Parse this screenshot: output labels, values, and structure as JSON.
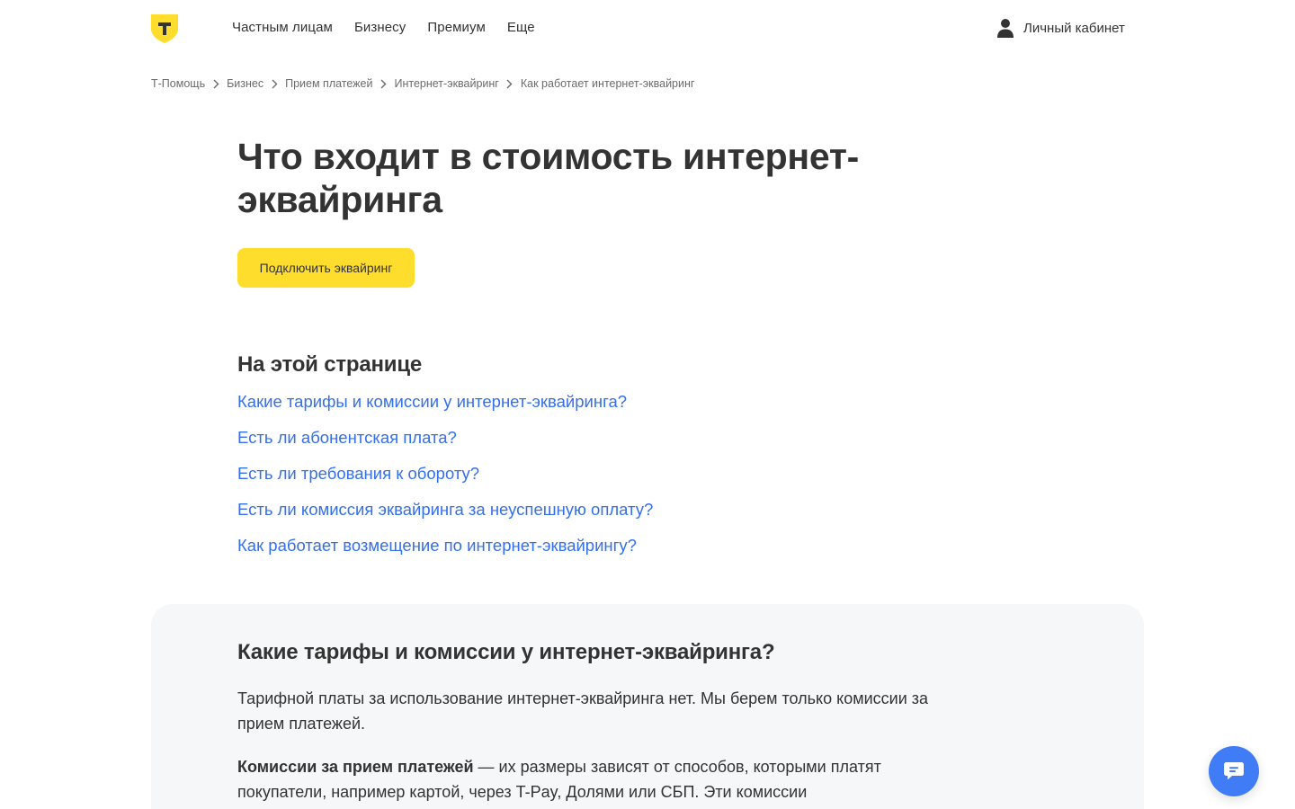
{
  "header": {
    "nav": [
      "Частным лицам",
      "Бизнесу",
      "Премиум",
      "Еще"
    ],
    "account_label": "Личный кабинет"
  },
  "breadcrumb": [
    "Т-Помощь",
    "Бизнес",
    "Прием платежей",
    "Интернет-эквайринг",
    "Как работает интернет-эквайринг"
  ],
  "main": {
    "title": "Что входит в стоимость интернет-эквайринга",
    "cta_label": "Подключить эквайринг",
    "toc_title": "На этой странице",
    "toc": [
      "Какие тарифы и комиссии у интернет-эквайринга?",
      "Есть ли абонентская плата?",
      "Есть ли требования к обороту?",
      "Есть ли комиссия эквайринга за неуспешную оплату?",
      "Как работает возмещение по интернет-эквайрингу?"
    ]
  },
  "section": {
    "title": "Какие тарифы и комиссии у интернет-эквайринга?",
    "p1": "Тарифной платы за использование интернет-эквайринга нет. Мы берем только комиссии за прием платежей.",
    "p2_bold": "Комиссии за прием платежей",
    "p2_rest": " — их размеры зависят от способов, которыми платят покупатели, например картой, через T-Pay, Долями или СБП. Эти комиссии"
  },
  "colors": {
    "accent_yellow": "#ffdd2d",
    "link_blue": "#336fee",
    "chat_blue": "#3f7cf6",
    "card_bg": "#f6f7f8"
  },
  "icons": [
    "t-logo-icon",
    "user-icon",
    "chevron-right-icon",
    "chat-icon"
  ]
}
